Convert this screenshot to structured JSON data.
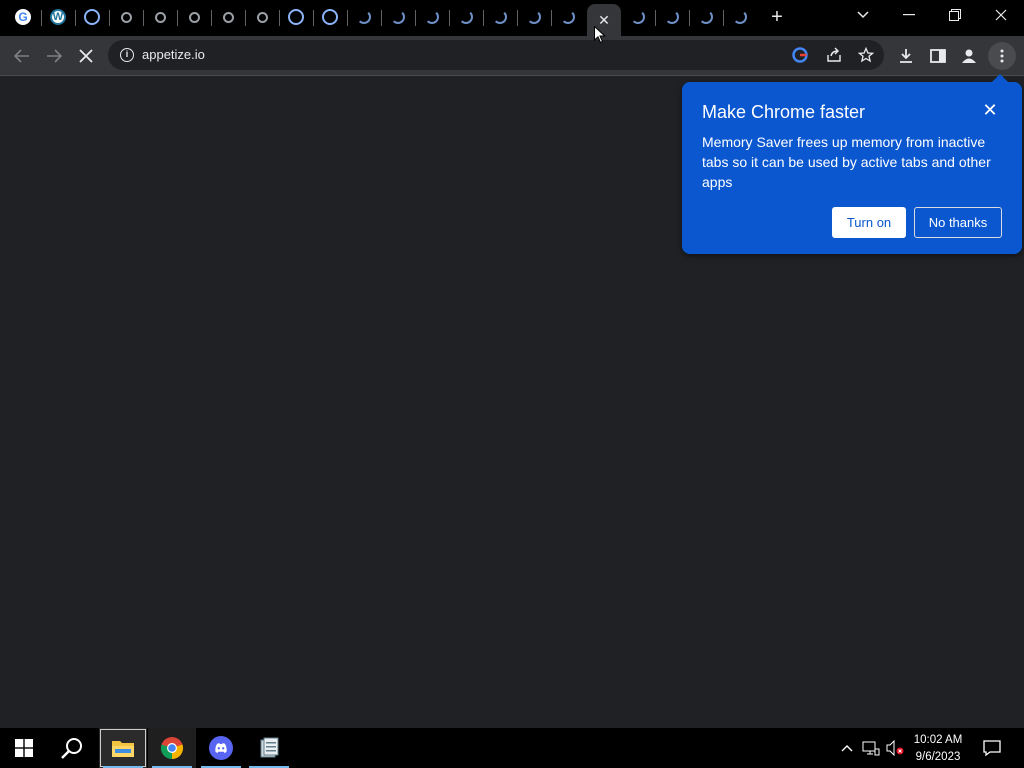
{
  "browser": {
    "url": "appetize.io",
    "tab_close_glyph": "✕",
    "new_tab_glyph": "+"
  },
  "bubble": {
    "title": "Make Chrome faster",
    "body": "Memory Saver frees up memory from inactive tabs so it can be used by active tabs and other apps",
    "primary_label": "Turn on",
    "secondary_label": "No thanks",
    "close_glyph": "✕",
    "color": "#0b57d0"
  },
  "taskbar": {
    "time": "10:02 AM",
    "date": "9/6/2023"
  },
  "tabs": [
    {
      "icon": "google-favicon"
    },
    {
      "icon": "wordpress-favicon"
    },
    {
      "icon": "site-favicon"
    },
    {
      "icon": "site-favicon"
    },
    {
      "icon": "site-favicon"
    },
    {
      "icon": "site-favicon"
    },
    {
      "icon": "site-favicon"
    },
    {
      "icon": "site-favicon"
    },
    {
      "icon": "site-favicon"
    },
    {
      "icon": "site-favicon"
    },
    {
      "icon": "loading-spinner"
    },
    {
      "icon": "loading-spinner"
    },
    {
      "icon": "loading-spinner"
    },
    {
      "icon": "loading-spinner"
    },
    {
      "icon": "loading-spinner"
    },
    {
      "icon": "loading-spinner"
    },
    {
      "icon": "loading-spinner"
    },
    {
      "icon": "close-icon",
      "active": true
    },
    {
      "icon": "loading-spinner"
    },
    {
      "icon": "loading-spinner"
    },
    {
      "icon": "loading-spinner"
    },
    {
      "icon": "loading-spinner"
    }
  ]
}
